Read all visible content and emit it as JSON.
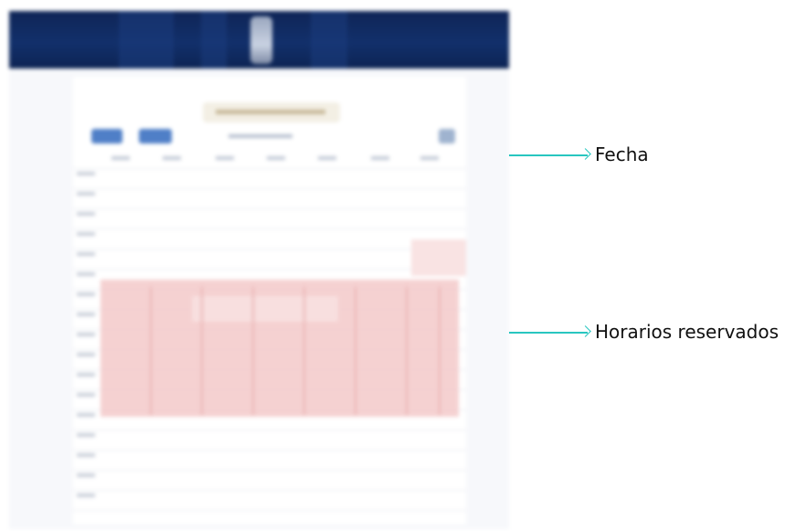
{
  "annotations": {
    "date_label": "Fecha",
    "booked_slots_label": "Horarios reservados"
  },
  "colors": {
    "header_navy": "#0f2557",
    "annotation_cyan": "#28c6c0",
    "booked_slot": "#f3c9c9",
    "nav_button_blue": "#4f7fc7"
  }
}
